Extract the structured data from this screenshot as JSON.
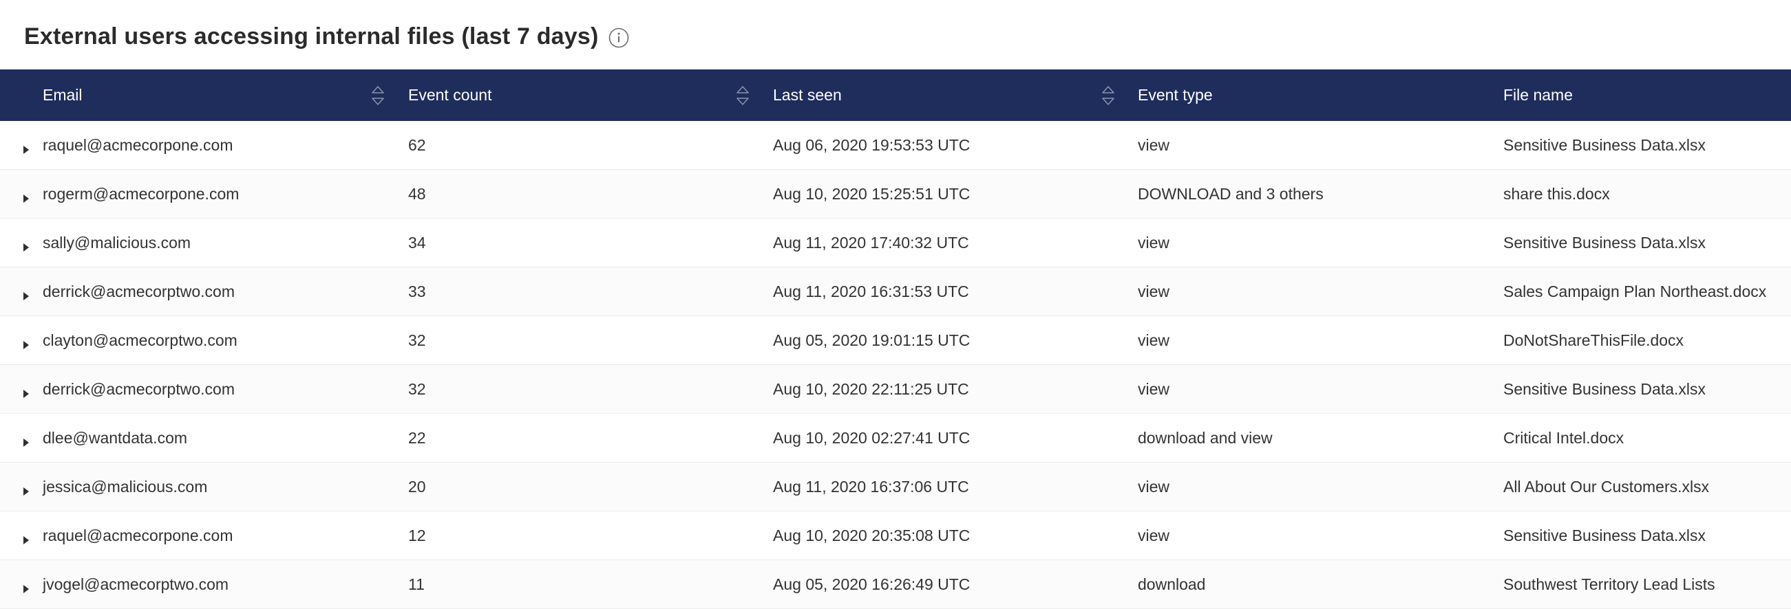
{
  "title": "External users accessing internal files (last 7 days)",
  "icons": {
    "info": "info-icon",
    "sort": "sort-icon",
    "expand": "caret-right-icon"
  },
  "colors": {
    "header_bg": "#1f2d5c",
    "header_text": "#ffffff",
    "text": "#333333"
  },
  "columns": [
    {
      "key": "email",
      "label": "Email",
      "sortable": true
    },
    {
      "key": "count",
      "label": "Event count",
      "sortable": true
    },
    {
      "key": "last_seen",
      "label": "Last seen",
      "sortable": true
    },
    {
      "key": "event_type",
      "label": "Event type",
      "sortable": false
    },
    {
      "key": "file_name",
      "label": "File name",
      "sortable": false
    }
  ],
  "rows": [
    {
      "email": "raquel@acmecorpone.com",
      "count": "62",
      "last_seen": "Aug 06, 2020 19:53:53 UTC",
      "event_type": "view",
      "file_name": "Sensitive Business Data.xlsx"
    },
    {
      "email": "rogerm@acmecorpone.com",
      "count": "48",
      "last_seen": "Aug 10, 2020 15:25:51 UTC",
      "event_type": "DOWNLOAD and 3 others",
      "file_name": "share this.docx"
    },
    {
      "email": "sally@malicious.com",
      "count": "34",
      "last_seen": "Aug 11, 2020 17:40:32 UTC",
      "event_type": "view",
      "file_name": "Sensitive Business Data.xlsx"
    },
    {
      "email": "derrick@acmecorptwo.com",
      "count": "33",
      "last_seen": "Aug 11, 2020 16:31:53 UTC",
      "event_type": "view",
      "file_name": "Sales Campaign Plan Northeast.docx"
    },
    {
      "email": "clayton@acmecorptwo.com",
      "count": "32",
      "last_seen": "Aug 05, 2020 19:01:15 UTC",
      "event_type": "view",
      "file_name": "DoNotShareThisFile.docx"
    },
    {
      "email": "derrick@acmecorptwo.com",
      "count": "32",
      "last_seen": "Aug 10, 2020 22:11:25 UTC",
      "event_type": "view",
      "file_name": "Sensitive Business Data.xlsx"
    },
    {
      "email": "dlee@wantdata.com",
      "count": "22",
      "last_seen": "Aug 10, 2020 02:27:41 UTC",
      "event_type": "download and view",
      "file_name": "Critical Intel.docx"
    },
    {
      "email": "jessica@malicious.com",
      "count": "20",
      "last_seen": "Aug 11, 2020 16:37:06 UTC",
      "event_type": "view",
      "file_name": "All About Our Customers.xlsx"
    },
    {
      "email": "raquel@acmecorpone.com",
      "count": "12",
      "last_seen": "Aug 10, 2020 20:35:08 UTC",
      "event_type": "view",
      "file_name": "Sensitive Business Data.xlsx"
    },
    {
      "email": "jvogel@acmecorptwo.com",
      "count": "11",
      "last_seen": "Aug 05, 2020 16:26:49 UTC",
      "event_type": "download",
      "file_name": "Southwest Territory Lead Lists"
    }
  ]
}
